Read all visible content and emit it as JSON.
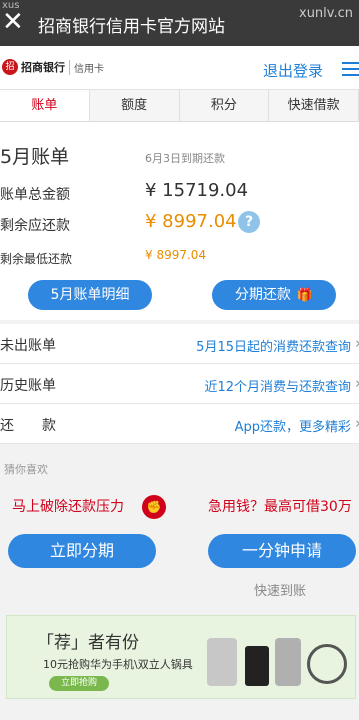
{
  "window": {
    "close_glyph": "✕",
    "title": "招商银行信用卡官方网站",
    "watermark": "xunlv.cn",
    "watermark_left": "xus"
  },
  "header": {
    "logo_name": "招商银行",
    "logo_sub": "信用卡",
    "logout": "退出登录"
  },
  "tabs": [
    {
      "label": "账单",
      "active": true
    },
    {
      "label": "额度",
      "active": false
    },
    {
      "label": "积分",
      "active": false
    },
    {
      "label": "快速借款",
      "active": false
    }
  ],
  "bill": {
    "month": "5月账单",
    "due_date": "6月3日到期还款",
    "total_label": "账单总金额",
    "total_value": "¥ 15719.04",
    "remaining_label": "剩余应还款",
    "remaining_value": "¥ 8997.04",
    "help_glyph": "?",
    "min_label": "剩余最低还款",
    "min_value": "¥ 8997.04",
    "detail_button": "5月账单明细",
    "installment_button": "分期还款"
  },
  "list": [
    {
      "label": "未出账单",
      "action": "5月15日起的消费还款查询"
    },
    {
      "label": "历史账单",
      "action": "近12个月消费与还款查询"
    },
    {
      "label": "还　　款",
      "action": "App还款，更多精彩"
    }
  ],
  "recommend": {
    "heading": "猜你喜欢",
    "promo_left": "马上破除还款压力",
    "promo_right": "急用钱？最高可借30万",
    "button_left": "立即分期",
    "button_right": "一分钟申请",
    "fast_note": "快速到账"
  },
  "banner": {
    "title": "「荐」者有份",
    "subtitle": "10元抢购华为手机\\双立人锅具",
    "cta": "立即抢购"
  },
  "colors": {
    "accent_blue": "#2f87e0",
    "link_blue": "#1f7fd6",
    "brand_red": "#d0021b",
    "amount_orange": "#e98d00"
  }
}
